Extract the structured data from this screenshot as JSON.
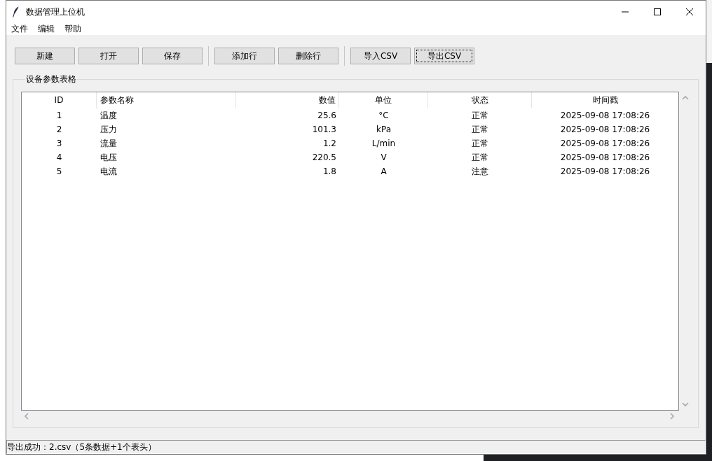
{
  "window": {
    "title": "数据管理上位机"
  },
  "menu": [
    {
      "label": "文件"
    },
    {
      "label": "编辑"
    },
    {
      "label": "帮助"
    }
  ],
  "toolbar": {
    "groups": [
      {
        "buttons": [
          {
            "label": "新建",
            "focused": false
          },
          {
            "label": "打开",
            "focused": false
          },
          {
            "label": "保存",
            "focused": false
          }
        ]
      },
      {
        "buttons": [
          {
            "label": "添加行",
            "focused": false
          },
          {
            "label": "删除行",
            "focused": false
          }
        ]
      },
      {
        "buttons": [
          {
            "label": "导入CSV",
            "focused": false
          },
          {
            "label": "导出CSV",
            "focused": true
          }
        ]
      }
    ]
  },
  "table_frame": {
    "title": "设备参数表格",
    "table": {
      "columns": [
        "ID",
        "参数名称",
        "数值",
        "单位",
        "状态",
        "时间戳"
      ],
      "rows": [
        {
          "cells": [
            "1",
            "温度",
            "25.6",
            "°C",
            "正常",
            "2025-09-08 17:08:26"
          ],
          "selected": false
        },
        {
          "cells": [
            "2",
            "压力",
            "101.3",
            "kPa",
            "正常",
            "2025-09-08 17:08:26"
          ],
          "selected": false
        },
        {
          "cells": [
            "3",
            "流量",
            "1.2",
            "L/min",
            "正常",
            "2025-09-08 17:08:26"
          ],
          "selected": false
        },
        {
          "cells": [
            "4",
            "电压",
            "220.5",
            "V",
            "正常",
            "2025-09-08 17:08:26"
          ],
          "selected": false
        },
        {
          "cells": [
            "5",
            "电流",
            "1.8",
            "A",
            "注意",
            "2025-09-08 17:08:26"
          ],
          "selected": false
        }
      ]
    }
  },
  "status_bar": {
    "text": "导出成功：2.csv（5条数据+1个表头）"
  }
}
